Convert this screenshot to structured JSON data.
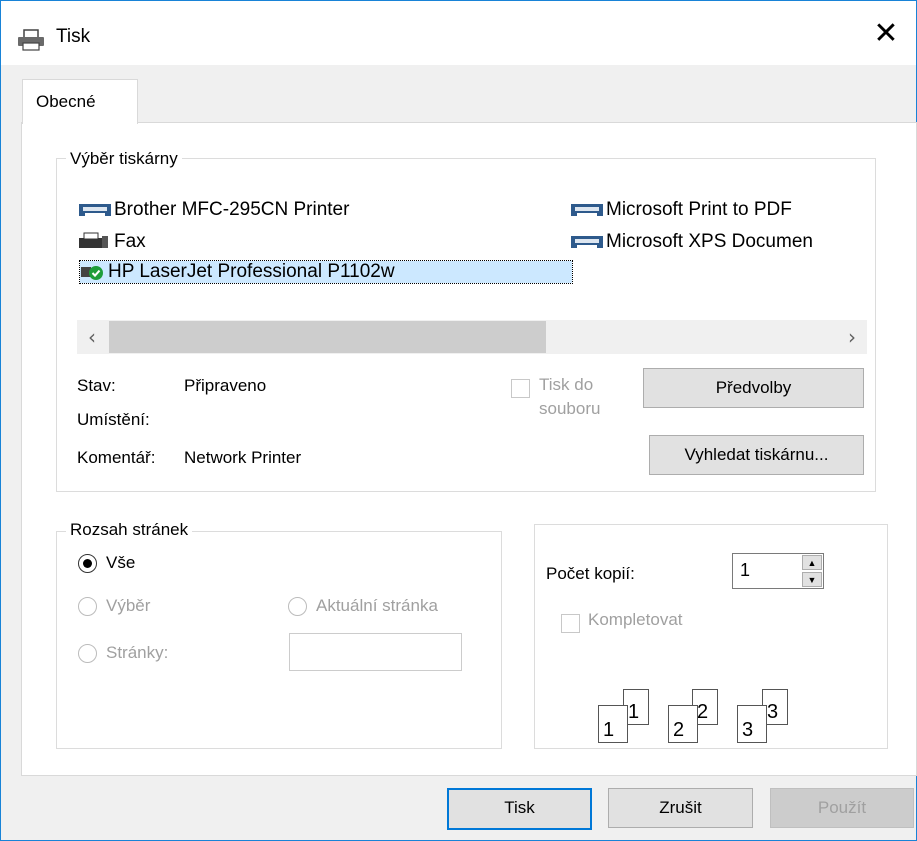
{
  "window": {
    "title": "Tisk",
    "close_glyph": "✕"
  },
  "tabs": [
    {
      "label": "Obecné",
      "active": true
    }
  ],
  "printer_section": {
    "legend": "Výběr tiskárny",
    "printers": [
      {
        "name": "Brother MFC-295CN Printer",
        "icon": "printer-icon"
      },
      {
        "name": "Microsoft Print to PDF",
        "icon": "printer-icon"
      },
      {
        "name": "Fax",
        "icon": "fax-icon"
      },
      {
        "name": "Microsoft XPS Documen",
        "icon": "printer-icon"
      },
      {
        "name": "HP LaserJet Professional P1102w",
        "icon": "default-printer-icon",
        "selected": true
      }
    ],
    "status_label": "Stav:",
    "status_value": "Připraveno",
    "location_label": "Umístění:",
    "comment_label": "Komentář:",
    "comment_value": "Network Printer",
    "print_to_file_line1": "Tisk do",
    "print_to_file_line2": "souboru",
    "preferences_button": "Předvolby",
    "find_printer_button": "Vyhledat tiskárnu..."
  },
  "page_range": {
    "legend": "Rozsah stránek",
    "all_label": "Vše",
    "selection_label": "Výběr",
    "current_page_label": "Aktuální stránka",
    "pages_label": "Stránky:",
    "pages_value": ""
  },
  "copies": {
    "label": "Počet kopií:",
    "value": "1",
    "collate_label": "Kompletovat",
    "collate_checked": false,
    "page_numbers": [
      "1",
      "1",
      "2",
      "2",
      "3",
      "3"
    ]
  },
  "buttons": {
    "print": "Tisk",
    "cancel": "Zrušit",
    "apply": "Použít"
  }
}
